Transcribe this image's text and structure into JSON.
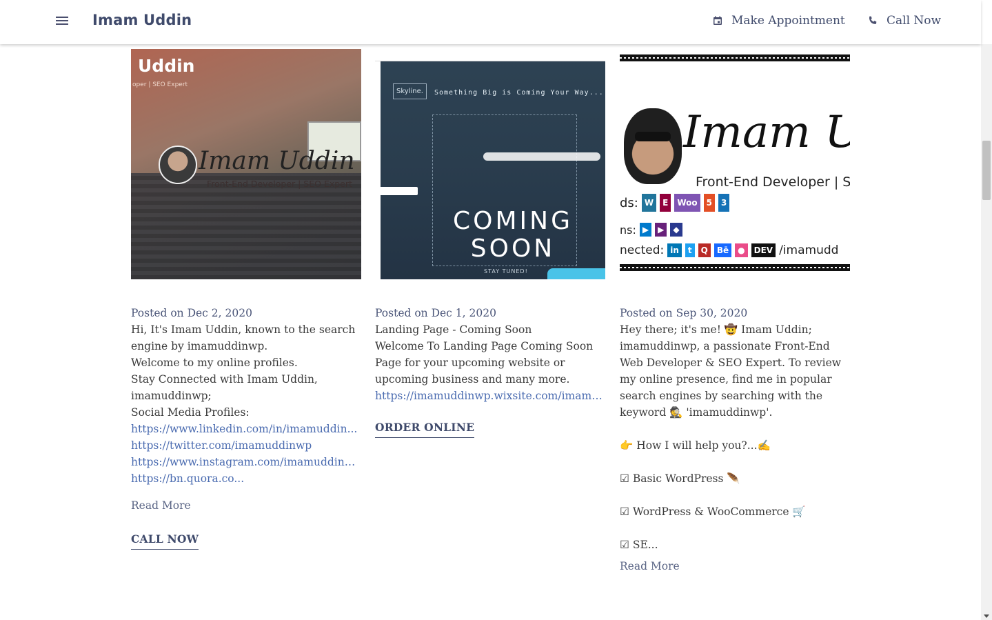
{
  "header": {
    "brand": "Imam Uddin",
    "appointment_label": "Make Appointment",
    "call_label": "Call Now"
  },
  "icons": {
    "menu": "menu-icon",
    "appointment": "calendar-icon",
    "call": "phone-icon"
  },
  "posts": [
    {
      "date": "Posted on Dec 2, 2020",
      "thumb": {
        "title": "Uddin",
        "subtitle": "oper | SEO Expert",
        "signature": "Imam Uddin",
        "role": "Front-End Developer | SEO Expert"
      },
      "lines": [
        "Hi, It's Imam Uddin, known to the search",
        "engine by imamuddinwp.",
        "Welcome to my online profiles.",
        "Stay Connected with Imam Uddin,",
        "imamuddinwp;",
        "Social Media Profiles:"
      ],
      "links": [
        "https://www.linkedin.com/in/imamuddin...",
        "https://twitter.com/imamuddinwp",
        "https://www.instagram.com/imamuddinw...",
        "https://bn.quora.co..."
      ],
      "read_more": "Read More",
      "cta": "CALL NOW"
    },
    {
      "date": "Posted on Dec 1, 2020",
      "thumb": {
        "brand": "Skyline.",
        "tagline": "Something Big is Coming Your Way...",
        "headline1": "COMING",
        "headline2": "SOON",
        "footer": "STAY TUNED!"
      },
      "lines": [
        "Landing Page - Coming Soon",
        "Welcome To Landing Page Coming Soon",
        "Page for your upcoming website or",
        "upcoming business and many more."
      ],
      "links": [
        "https://imamuddinwp.wixsite.com/imamu..."
      ],
      "cta": "ORDER ONLINE"
    },
    {
      "date": "Posted on Sep 30, 2020",
      "thumb": {
        "signature": "Imam Ud",
        "role": "Front-End Developer | SEO",
        "row_a_prefix": "ds:",
        "row_b_prefix": "ns:",
        "row_c_prefix": "nected:",
        "row_c_suffix": "/imamudd"
      },
      "lines": [
        "Hey there; it's me! 🤠 Imam Uddin;",
        "imamuddinwp, a passionate Front-End",
        "Web Developer & SEO Expert. To review",
        "my online presence, find me in popular",
        "search engines by searching with the",
        "keyword 🕵 'imamuddinwp'."
      ],
      "bullets": [
        "👉 How I will help you?...✍",
        "☑ Basic WordPress 🪶",
        "☑ WordPress & WooCommerce 🛒",
        "☑ SE..."
      ],
      "read_more": "Read More"
    }
  ]
}
